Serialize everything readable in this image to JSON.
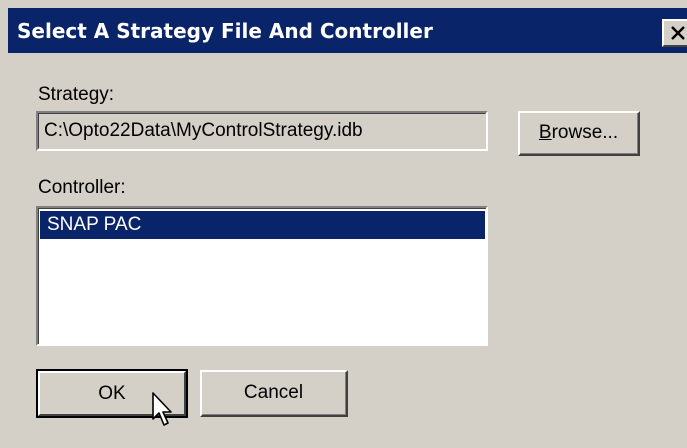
{
  "dialog": {
    "title": "Select A Strategy File And Controller",
    "close_icon": "close-icon"
  },
  "strategy": {
    "label": "Strategy:",
    "value": "C:\\Opto22Data\\MyControlStrategy.idb",
    "browse_label_underlined": "B",
    "browse_label_rest": "rowse..."
  },
  "controller": {
    "label": "Controller:",
    "items": [
      "SNAP PAC"
    ],
    "selected": "SNAP PAC"
  },
  "buttons": {
    "ok_label": "OK",
    "cancel_label": "Cancel"
  },
  "colors": {
    "titlebar": "#0a246a",
    "dialog_bg": "#d4d0c8",
    "selection": "#0a246a"
  },
  "cursor_icon": "arrow-cursor-icon"
}
